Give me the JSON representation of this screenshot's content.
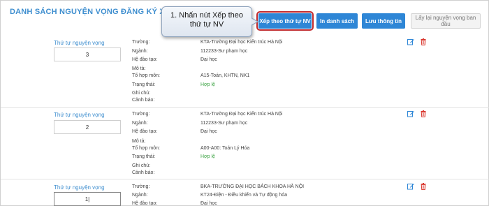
{
  "header": {
    "title": "DANH SÁCH NGUYỆN VỌNG ĐĂNG KÝ XÉT TUYỂN ĐH/CĐ"
  },
  "callout": {
    "text": "1. Nhấn nút Xếp theo thứ tự NV"
  },
  "toolbar": {
    "sort_label": "Xếp theo thứ tự NV",
    "print_label": "In danh sách",
    "save_label": "Lưu thông tin",
    "reset_label": "Lấy lại nguyện vọng ban đầu"
  },
  "labels": {
    "priority": "Thứ tự nguyện vọng",
    "school": "Trường:",
    "major": "Ngành:",
    "level": "Hệ đào tạo:",
    "desc": "Mô tả:",
    "combo": "Tổ hợp môn:",
    "status": "Trạng thái:",
    "note": "Ghi chú:",
    "warning": "Cảnh báo:"
  },
  "entries": [
    {
      "priority": "3",
      "school": "KTA-Trường Đại học Kiến trúc Hà Nội",
      "major": "112233-Sư phạm học",
      "level": "Đại học",
      "desc": "",
      "combo": "A15-Toán, KHTN, NK1",
      "status": "Hợp lệ",
      "note": "",
      "warning": ""
    },
    {
      "priority": "2",
      "school": "KTA-Trường Đại học Kiến trúc Hà Nội",
      "major": "112233-Sư phạm học",
      "level": "Đại học",
      "desc": "",
      "combo": "A00-A00: Toán Lý Hóa",
      "status": "Hợp lệ",
      "note": "",
      "warning": ""
    },
    {
      "priority": "1|",
      "school": "BKA-TRƯỜNG ĐẠI HỌC BÁCH KHOA HÀ NỘI",
      "major": "KT24-Điện - Điều khiển và Tự động hóa",
      "level": "Đại học"
    }
  ],
  "colors": {
    "accent": "#2e86d6",
    "title": "#3e8ecf",
    "valid": "#3aa241",
    "delete": "#d9342b",
    "highlight": "#c0282c"
  }
}
